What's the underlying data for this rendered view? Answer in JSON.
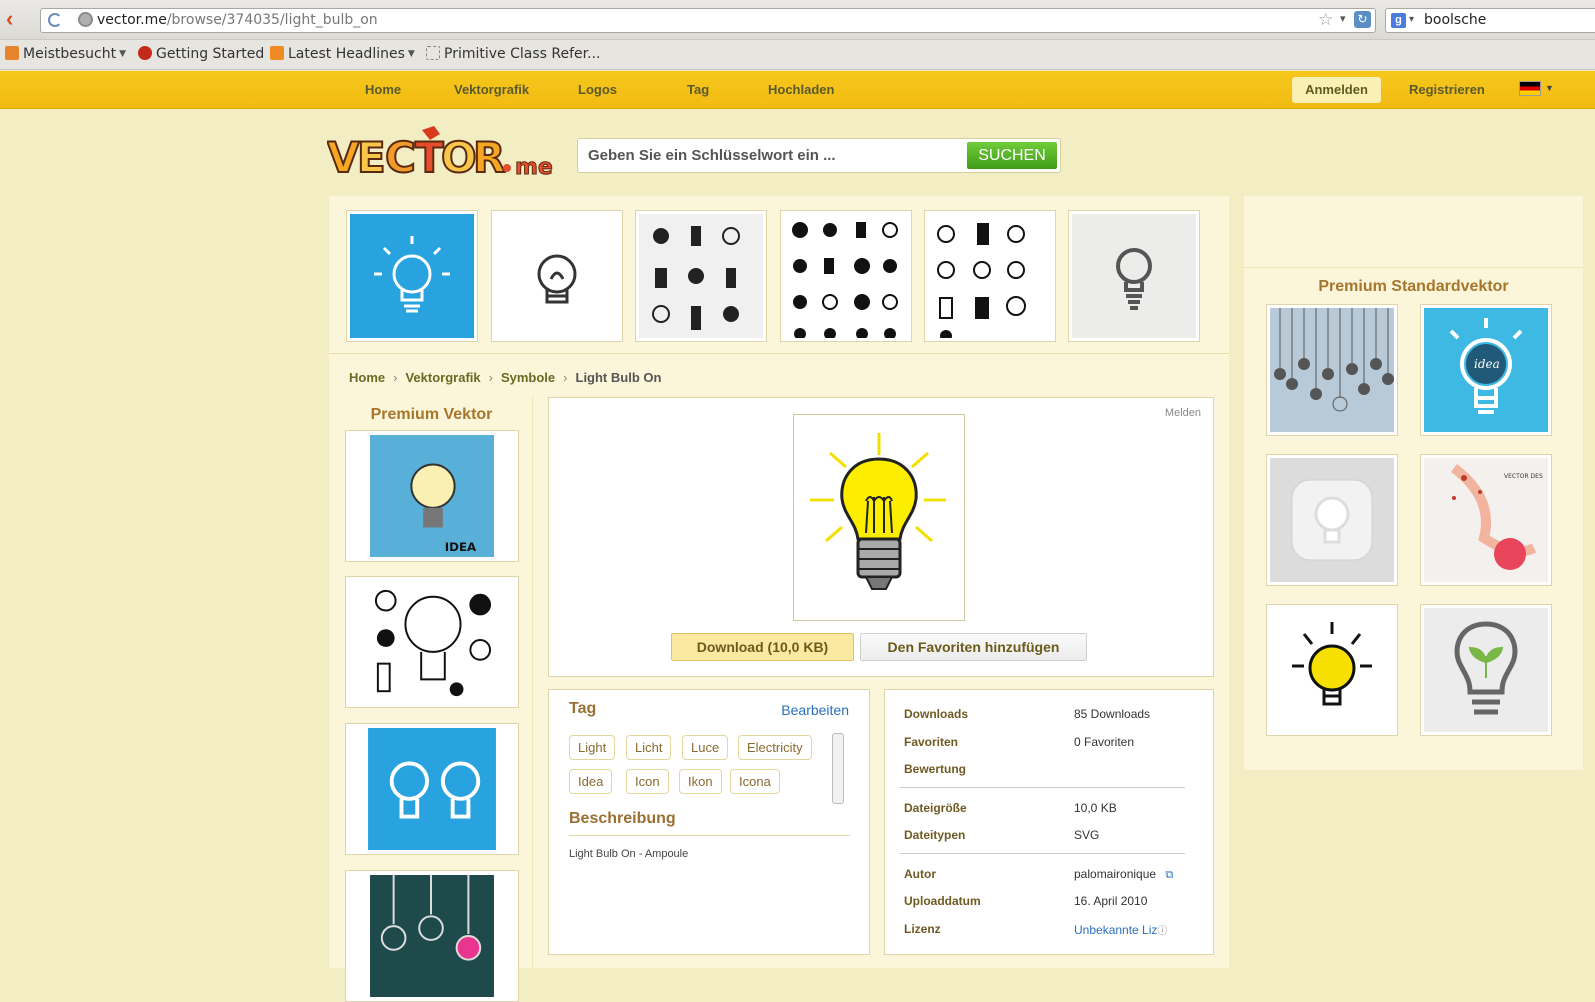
{
  "browser": {
    "url_host": "vector.me",
    "url_path": "/browse/374035/light_bulb_on",
    "search_value": "boolsche",
    "bookmarks": [
      "Meistbesucht",
      "Getting Started",
      "Latest Headlines",
      "Primitive Class Refer..."
    ]
  },
  "nav": {
    "items": [
      "Home",
      "Vektorgrafik",
      "Logos",
      "Tag",
      "Hochladen"
    ],
    "login": "Anmelden",
    "register": "Registrieren"
  },
  "header": {
    "search_placeholder": "Geben Sie ein Schlüsselwort ein ...",
    "search_button": "SUCHEN"
  },
  "breadcrumb": [
    "Home",
    "Vektorgrafik",
    "Symbole",
    "Light Bulb On"
  ],
  "premium_left": {
    "title": "Premium Vektor"
  },
  "preview": {
    "report": "Melden",
    "download": "Download (10,0 KB)",
    "favorite": "Den Favoriten hinzufügen"
  },
  "tags": {
    "title": "Tag",
    "edit": "Bearbeiten",
    "items": [
      "Light",
      "Licht",
      "Luce",
      "Electricity",
      "Idea",
      "Icon",
      "Ikon",
      "Icona"
    ]
  },
  "description": {
    "title": "Beschreibung",
    "text": "Light Bulb On - Ampoule"
  },
  "info": {
    "downloads_label": "Downloads",
    "downloads_value": "85 Downloads",
    "favorites_label": "Favoriten",
    "favorites_value": "0 Favoriten",
    "rating_label": "Bewertung",
    "size_label": "Dateigröße",
    "size_value": "10,0 KB",
    "types_label": "Dateitypen",
    "types_value": "SVG",
    "author_label": "Autor",
    "author_value": "palomaironique",
    "date_label": "Uploaddatum",
    "date_value": "16. April 2010",
    "license_label": "Lizenz",
    "license_value": "Unbekannte Liz"
  },
  "premium_right": {
    "title": "Premium Standardvektor"
  },
  "icons": [
    "back-arrow-icon",
    "refresh-icon",
    "globe-icon",
    "star-icon",
    "reload-icon",
    "google-icon",
    "flag-de-icon",
    "external-link-icon",
    "help-icon"
  ],
  "colors": {
    "nav_bg": "#f2bb12",
    "page_bg": "#f3edc4",
    "panel_bg": "#fbf6d9",
    "accent_gold": "#a7762d",
    "search_green": "#4fae22",
    "link_blue": "#2a6fbb"
  }
}
